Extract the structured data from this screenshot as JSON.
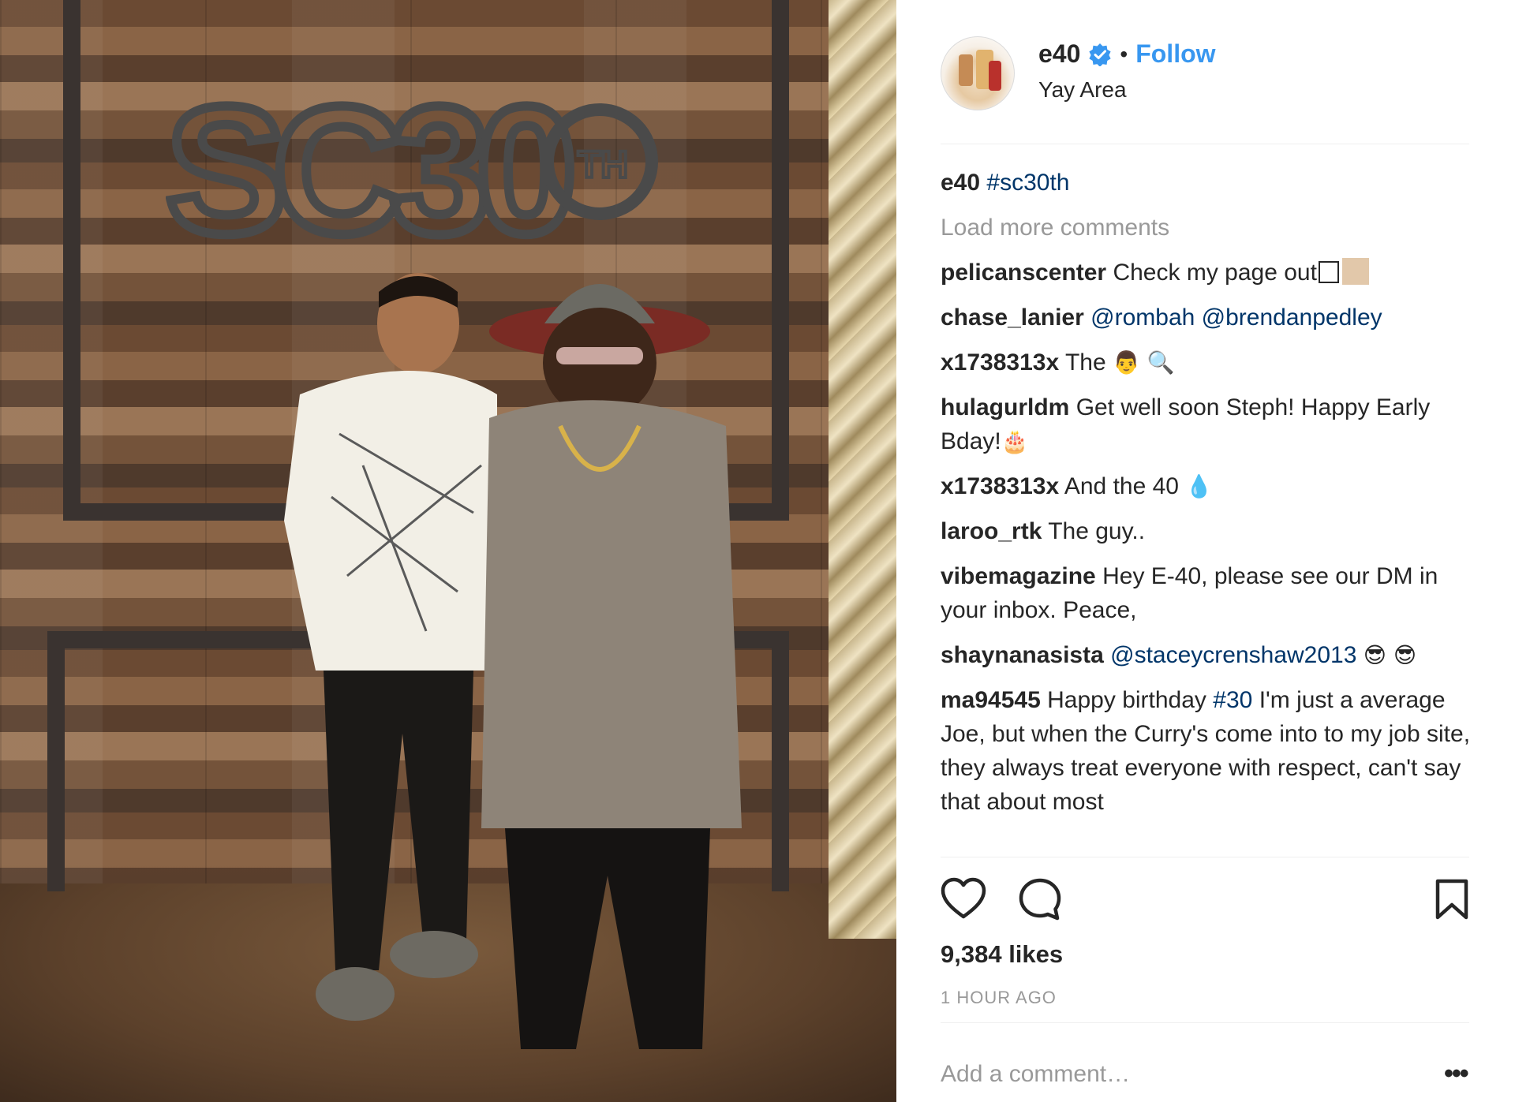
{
  "post": {
    "username": "e40",
    "verified": true,
    "follow_label": "Follow",
    "separator": "•",
    "location": "Yay Area",
    "caption": {
      "username": "e40",
      "hashtag": "#sc30th"
    },
    "load_more_label": "Load more comments",
    "comments": [
      {
        "user": "pelicanscenter",
        "text": "Check my page out"
      },
      {
        "user": "chase_lanier",
        "mentions": [
          "@rombah",
          "@brendanpedley"
        ]
      },
      {
        "user": "x1738313x",
        "text": "The",
        "emojis": "👨 🔍"
      },
      {
        "user": "hulagurldm",
        "text": "Get well soon Steph! Happy Early Bday!",
        "emojis": "🎂"
      },
      {
        "user": "x1738313x",
        "text": "And the 40",
        "emojis": "💧"
      },
      {
        "user": "laroo_rtk",
        "text": "The guy.."
      },
      {
        "user": "vibemagazine",
        "text": "Hey E-40, please see our DM in your inbox. Peace,"
      },
      {
        "user": "shaynanasista",
        "mention": "@staceycrenshaw2013",
        "emojis": "😎 😎"
      },
      {
        "user": "ma94545",
        "text_before": "Happy birthday",
        "hashtag": "#30",
        "text_after": "I'm just a average Joe, but when the Curry's come into to my job site, they always treat everyone with respect, can't say that about most"
      }
    ],
    "likes": "9,384 likes",
    "time": "1 HOUR AGO",
    "add_comment_placeholder": "Add a comment…",
    "more_label": "•••",
    "photo": {
      "wall_logo": "SC30",
      "wall_logo_sup": "TH"
    },
    "icons": {
      "verified": "verified-badge-icon",
      "like": "heart-icon",
      "comment": "comment-bubble-icon",
      "save": "bookmark-icon"
    },
    "colors": {
      "link": "#003569",
      "follow": "#3897f0",
      "muted": "#999999",
      "text": "#262626"
    }
  }
}
